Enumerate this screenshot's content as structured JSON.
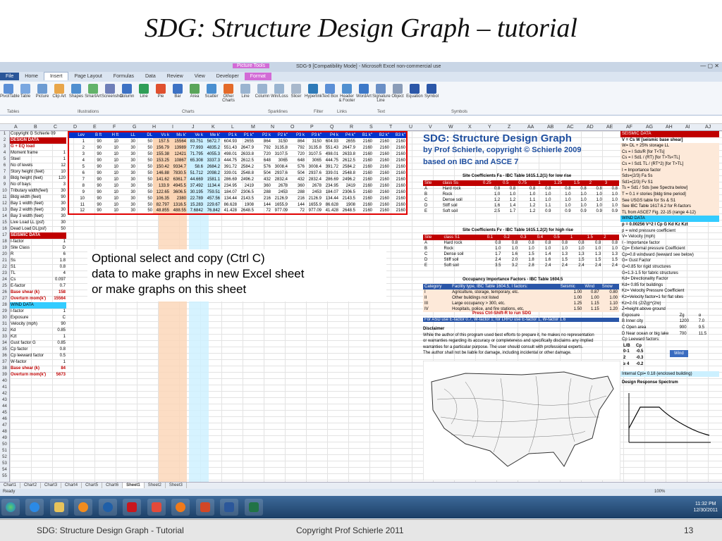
{
  "slide_title": "SDG: Structure Design Graph – tutorial",
  "window": {
    "title": "SDG-9 [Compatibility Mode] - Microsoft Excel non-commercial use",
    "context_tab": "Picture Tools"
  },
  "ribbon_tabs": [
    "File",
    "Home",
    "Insert",
    "Page Layout",
    "Formulas",
    "Data",
    "Review",
    "View",
    "Developer",
    "Format"
  ],
  "ribbon": {
    "groups": [
      "Tables",
      "Illustrations",
      "Charts",
      "Sparklines",
      "Filter",
      "Links",
      "Text",
      "Symbols"
    ],
    "buttons": [
      "PivotTable",
      "Table",
      "Picture",
      "Clip Art",
      "Shapes",
      "SmartArt",
      "Screenshot",
      "Column",
      "Line",
      "Pie",
      "Bar",
      "Area",
      "Scatter",
      "Other Charts",
      "Line",
      "Column",
      "Win/Loss",
      "Slicer",
      "Hyperlink",
      "Text Box",
      "Header & Footer",
      "WordArt",
      "Signature Line",
      "Object",
      "Equation",
      "Symbol"
    ]
  },
  "columns": [
    "A",
    "B",
    "C",
    "D",
    "E",
    "F",
    "G",
    "H",
    "I",
    "J",
    "K",
    "L",
    "M",
    "N",
    "O",
    "P",
    "Q",
    "R",
    "S",
    "T",
    "U",
    "V",
    "W",
    "X",
    "Y",
    "Z",
    "AA",
    "AB",
    "AC",
    "AD",
    "AE",
    "AF",
    "AG",
    "AH",
    "AI",
    "AJ"
  ],
  "params": [
    [
      "Copyright G Schierle 09",
      ""
    ],
    [
      "DESIGN DATA",
      ""
    ],
    [
      "G + EQ load",
      ""
    ],
    [
      "Moment frame",
      "1"
    ],
    [
      "Steel",
      "1"
    ],
    [
      "No of levels",
      "12"
    ],
    [
      "Story height (feet)",
      "10"
    ],
    [
      "Bldg height (feet)",
      "120"
    ],
    [
      "No of bays",
      "3"
    ],
    [
      "Tributary width(feet)",
      "30"
    ],
    [
      "Bldg width (feet)",
      "90"
    ],
    [
      "Bay 1 width (feet)",
      "30"
    ],
    [
      "Bay 2 width (feet)",
      "30"
    ],
    [
      "Bay 3 width (feet)",
      "30"
    ],
    [
      "Live Load LL (psf)",
      "30"
    ],
    [
      "Dead Load DL(psf)",
      "50"
    ],
    [
      "SEISMIC DATA",
      ""
    ],
    [
      "I-factor",
      "1"
    ],
    [
      "Site Class",
      "D"
    ],
    [
      "R",
      "6"
    ],
    [
      "Ss",
      "1.8"
    ],
    [
      "S1",
      "0.8"
    ],
    [
      "TL",
      "4"
    ],
    [
      "Cs",
      "0.097"
    ],
    [
      "E-factor",
      "0.7"
    ],
    [
      "Base shear (k)",
      "158"
    ],
    [
      "Overturn mom(k')",
      "15564"
    ],
    [
      "WIND DATA",
      ""
    ],
    [
      "I-factor",
      "1"
    ],
    [
      "Exposure",
      "C"
    ],
    [
      "Velocity (mph)",
      "90"
    ],
    [
      "Kd",
      "0.85"
    ],
    [
      "Kzt",
      "1"
    ],
    [
      "Gust factor G",
      "0.85"
    ],
    [
      "Cp factor",
      "0.8"
    ],
    [
      "Cp leeward factor",
      "0.5"
    ],
    [
      "W-factor",
      "1"
    ],
    [
      "Base shear (k)",
      "84"
    ],
    [
      "Overturn mom(k')",
      "5673"
    ]
  ],
  "table_headers": [
    "Lev",
    "B ft",
    "H ft",
    "LL",
    "DL",
    "Vs k",
    "Ms k'",
    "Ve k",
    "Me k'",
    "P1 k",
    "P1 k\"",
    "P2 k",
    "P2 k\"",
    "P3 k",
    "P3 k\"",
    "P4 k",
    "P4 k\"",
    "B1 k\"",
    "B2 k\"",
    "B3 k\""
  ],
  "table_rows": [
    [
      "1",
      "90",
      "10",
      "30",
      "50",
      "157.5",
      "15564",
      "83.751",
      "5672.7",
      "604.93",
      "2655",
      "864",
      "3150",
      "864",
      "3150",
      "604.93",
      "2655",
      "2160",
      "2160",
      "2160"
    ],
    [
      "2",
      "90",
      "10",
      "30",
      "50",
      "156.79",
      "13989",
      "77.993",
      "4835.2",
      "551.43",
      "2647.9",
      "792",
      "3135.8",
      "792",
      "3135.8",
      "551.43",
      "2647.9",
      "2160",
      "2160",
      "2160"
    ],
    [
      "3",
      "90",
      "10",
      "30",
      "50",
      "155.38",
      "12421",
      "71.795",
      "4055.3",
      "498.01",
      "2633.8",
      "720",
      "3107.5",
      "720",
      "3107.5",
      "498.01",
      "2633.8",
      "2160",
      "2160",
      "2160"
    ],
    [
      "4",
      "90",
      "10",
      "30",
      "50",
      "153.25",
      "10867",
      "65.308",
      "3337.3",
      "444.75",
      "2612.5",
      "648",
      "3065",
      "648",
      "3065",
      "444.75",
      "2612.5",
      "2160",
      "2160",
      "2160"
    ],
    [
      "5",
      "90",
      "10",
      "30",
      "50",
      "150.42",
      "9334.7",
      "58.6",
      "2684.2",
      "391.72",
      "2584.2",
      "576",
      "3008.4",
      "576",
      "3008.4",
      "391.72",
      "2584.2",
      "2160",
      "2160",
      "2160"
    ],
    [
      "6",
      "90",
      "10",
      "30",
      "50",
      "146.88",
      "7830.5",
      "51.712",
      "2098.2",
      "339.01",
      "2548.8",
      "504",
      "2937.6",
      "504",
      "2937.6",
      "339.01",
      "2548.8",
      "2160",
      "2160",
      "2160"
    ],
    [
      "7",
      "90",
      "10",
      "30",
      "50",
      "141.62",
      "6361.7",
      "44.669",
      "1581.1",
      "286.69",
      "2496.2",
      "432",
      "2832.4",
      "432",
      "2832.4",
      "286.69",
      "2496.2",
      "2160",
      "2160",
      "2160"
    ],
    [
      "8",
      "90",
      "10",
      "30",
      "50",
      "133.9",
      "4945.5",
      "37.492",
      "1134.4",
      "234.95",
      "2419",
      "360",
      "2678",
      "360",
      "2678",
      "234.95",
      "2419",
      "2160",
      "2160",
      "2160"
    ],
    [
      "9",
      "90",
      "10",
      "30",
      "50",
      "122.65",
      "3606.5",
      "30.195",
      "759.51",
      "184.07",
      "2306.5",
      "288",
      "2453",
      "288",
      "2453",
      "184.07",
      "2306.5",
      "2160",
      "2160",
      "2160"
    ],
    [
      "10",
      "90",
      "10",
      "30",
      "50",
      "106.35",
      "2380",
      "22.789",
      "457.56",
      "134.44",
      "2143.5",
      "216",
      "2126.9",
      "216",
      "2126.9",
      "134.44",
      "2143.5",
      "2160",
      "2160",
      "2160"
    ],
    [
      "11",
      "90",
      "10",
      "30",
      "50",
      "82.797",
      "1316.5",
      "15.283",
      "229.67",
      "86.628",
      "1908",
      "144",
      "1655.9",
      "144",
      "1655.9",
      "86.628",
      "1908",
      "2160",
      "2160",
      "2160"
    ],
    [
      "12",
      "90",
      "10",
      "30",
      "50",
      "48.855",
      "488.55",
      "7.6842",
      "76.842",
      "41.428",
      "2648.5",
      "72",
      "977.09",
      "72",
      "977.09",
      "41.428",
      "2648.5",
      "2160",
      "2160",
      "2160"
    ]
  ],
  "sdg_header": {
    "line1": "SDG: Structure Design Graph",
    "line2": "by Prof Schierle, copyright © Schierle 2009",
    "line3": "based on IBC and ASCE 7"
  },
  "fa_table": {
    "title": "Site Coefficients Fa - IBC Table 1615.1.2(1) for low rise",
    "header": [
      "Site",
      "class Ss",
      "0.25",
      "0.5",
      "0.75",
      "1",
      "1.25",
      "1.5",
      "2",
      "3"
    ],
    "rows": [
      [
        "A",
        "Hard rock",
        "0.8",
        "0.8",
        "0.8",
        "0.8",
        "0.8",
        "0.8",
        "0.8",
        "0.8"
      ],
      [
        "B",
        "Rock",
        "1.0",
        "1.0",
        "1.0",
        "1.0",
        "1.0",
        "1.0",
        "1.0",
        "1.0"
      ],
      [
        "C",
        "Dense soil",
        "1.2",
        "1.2",
        "1.1",
        "1.0",
        "1.0",
        "1.0",
        "1.0",
        "1.0"
      ],
      [
        "D",
        "Stiff soil",
        "1.6",
        "1.4",
        "1.2",
        "1.1",
        "1.0",
        "1.0",
        "1.0",
        "1.0"
      ],
      [
        "E",
        "Soft soil",
        "2.5",
        "1.7",
        "1.2",
        "0.9",
        "0.9",
        "0.9",
        "0.9",
        "0.9"
      ]
    ]
  },
  "fv_table": {
    "title": "Site Coefficients Fv - IBC Table 1615.1.2(2) for high rise",
    "header": [
      "Site",
      "class S1",
      "0.1",
      "0.2",
      "0.3",
      "0.4",
      "0.5",
      "1",
      "1.5",
      "2"
    ],
    "rows": [
      [
        "A",
        "Hard rock",
        "0.8",
        "0.8",
        "0.8",
        "0.8",
        "0.8",
        "0.8",
        "0.8",
        "0.8"
      ],
      [
        "B",
        "Rock",
        "1.0",
        "1.0",
        "1.0",
        "1.0",
        "1.0",
        "1.0",
        "1.0",
        "1.0"
      ],
      [
        "C",
        "Dense soil",
        "1.7",
        "1.6",
        "1.5",
        "1.4",
        "1.3",
        "1.3",
        "1.3",
        "1.3"
      ],
      [
        "D",
        "Stiff soil",
        "2.4",
        "2.0",
        "1.8",
        "1.6",
        "1.5",
        "1.5",
        "1.5",
        "1.5"
      ],
      [
        "E",
        "Soft soil",
        "3.5",
        "3.2",
        "2.8",
        "2.4",
        "2.4",
        "2.4",
        "2.4",
        "2.4"
      ]
    ]
  },
  "occ_table": {
    "title": "Occupancy Importance Factors - IBC Table 1604.5",
    "header": [
      "Category",
      "Facility type, IBC Table 1604.5, I factors:",
      "Seismic",
      "Wind",
      "Snow"
    ],
    "rows": [
      [
        "I",
        "Agriculture, storage, temporary, etc.",
        "1.00",
        "0.87",
        "0.80"
      ],
      [
        "II",
        "Other buildings not listed",
        "1.00",
        "1.00",
        "1.00"
      ],
      [
        "III",
        "Large occupancy > 300, etc.",
        "1.25",
        "1.15",
        "1.10"
      ],
      [
        "IV",
        "Hospitals, police, and fire stations, etc.",
        "1.50",
        "1.15",
        "1.20"
      ]
    ]
  },
  "asd_note": "For ASD use E-factor 0.7, W-factor 1; for LRFD use E-factor 1, W-factor 1.6",
  "disclaimer": {
    "title": "Disclaimer",
    "lines": [
      "While the author of this program used best efforts to prepare it, he makes no representation",
      "or warranties regarding its accuracy or completeness and specifically disclaims any implied",
      "warranties for a particular purpose. The user should consult with professional experts.",
      "The author shall not be liable for damage, including incidental or other damage."
    ]
  },
  "run_note": "Press Ctrl-Shift-R to run SDG",
  "right_col": {
    "seismic_hdr": "SEISMIC DATA",
    "seismic": [
      "V = Cs W     [seismic base shear]",
      "W= DL + 25% storage LL",
      "Cs = I Sds/R                 [for T<Ts]",
      "Cs = I Sd1 / (RT)           [for T>Ts<TL]",
      "Cs = I Sd1 TL / (RT^2)    [for T>TL]",
      "I = Importance factor",
      "Sds=(2/3) Fa Ss",
      "Sd1=(2/3) Fv S1",
      "Ts = Sd1 / Sds  [see Spectra below]",
      "T = 0.1 # stories   [bldg time period]",
      "See USGS table for Ss & S1",
      "See IBC Table 1617.6.2 for R-factors",
      "TL from ASCE7 Fig. 22-15 (range 4-12)"
    ],
    "wind_hdr": "WIND DATA",
    "wind": [
      "p = 0.00256 V^2 I Cp G Kd Kz Kzt",
      "p = wind pressure coefficient",
      "V= Velocity (mph)",
      "I - Importance factor",
      "Cp= External pressure Coefficient",
      "Cp=0.8 windward (leeward see below)",
      "G= Gust Factor",
      "G=0.85 for rigid structures",
      "G=1.3-1.5 for fabric structures",
      "Kd= Directionality Factor",
      "Kd= 0.85 for buildings",
      "Kz= Velocity Pressure Coefficient",
      "Kz=Velocity factor=1 for flat sites",
      "Kz=2.01 (Z/Zg)^(2/α)",
      "Z=height above ground"
    ],
    "exposure_hdr": [
      "Exposure",
      "Zg",
      "α"
    ],
    "exposure": [
      [
        "B  Inner city",
        "1200",
        "7.0"
      ],
      [
        "C  Open area",
        "900",
        "9.5"
      ],
      [
        "D  Near ocean or big lake",
        "700",
        "11.5"
      ]
    ],
    "cp": "Cp    Leeward factors:",
    "cp_rows": [
      [
        "L/B",
        "Cp"
      ],
      [
        "0-1",
        "-0.5"
      ],
      [
        "2",
        "-0.3"
      ],
      [
        "≥ 4",
        "-0.2"
      ]
    ],
    "wind_label": "Wind",
    "internal": "Internal Cpi= 0.18 (enclosed building)",
    "spectrum": "Design Response Spectrum"
  },
  "overlay": [
    "Optional select and copy (Ctrl C)",
    "data to make graphs in new Excel sheet",
    "or make graphs on this sheet"
  ],
  "sheet_tabs": [
    "Chart1",
    "Chart2",
    "Chart3",
    "Chart4",
    "Chart5",
    "Chart6",
    "Sheet1",
    "Sheet2",
    "Sheet3"
  ],
  "active_sheet": "Sheet1",
  "status": {
    "left": "Ready",
    "zoom": "100%"
  },
  "clock": {
    "time": "11:32 PM",
    "date": "12/30/2011"
  },
  "footer": {
    "left": "SDG: Structure Design Graph - Tutorial",
    "center": "Copyright Prof Schierle 2011",
    "page": "13"
  },
  "colors": {
    "blue_header": "#0033cc",
    "red_accent": "#c00000",
    "cyan": "#33ccff",
    "title_blue": "#1f4fa0"
  }
}
